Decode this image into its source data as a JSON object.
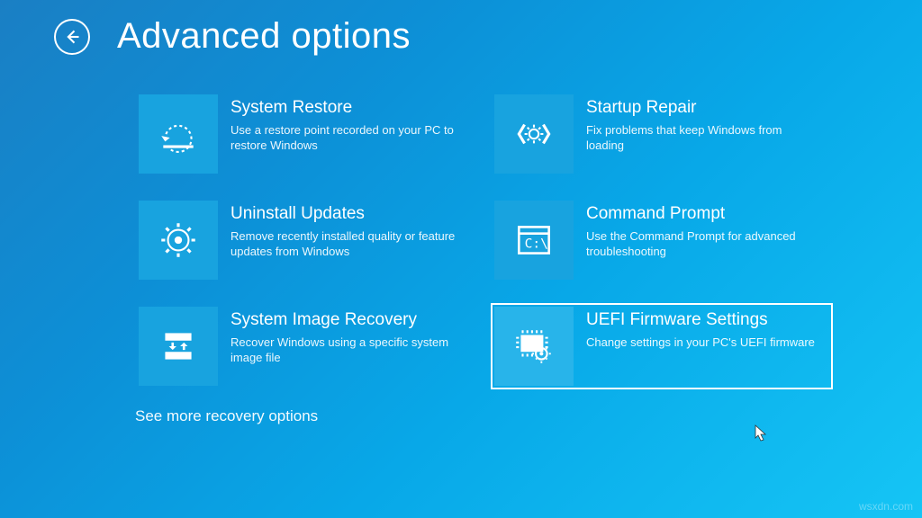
{
  "title": "Advanced options",
  "tiles": [
    {
      "id": "system-restore",
      "title": "System Restore",
      "desc": "Use a restore point recorded on your PC to restore Windows"
    },
    {
      "id": "startup-repair",
      "title": "Startup Repair",
      "desc": "Fix problems that keep Windows from loading"
    },
    {
      "id": "uninstall-updates",
      "title": "Uninstall Updates",
      "desc": "Remove recently installed quality or feature updates from Windows"
    },
    {
      "id": "command-prompt",
      "title": "Command Prompt",
      "desc": "Use the Command Prompt for advanced troubleshooting"
    },
    {
      "id": "system-image-recovery",
      "title": "System Image Recovery",
      "desc": "Recover Windows using a specific system image file"
    },
    {
      "id": "uefi-firmware-settings",
      "title": "UEFI Firmware Settings",
      "desc": "Change settings in your PC's UEFI firmware"
    }
  ],
  "moreLink": "See more recovery options",
  "watermark": "wsxdn.com"
}
